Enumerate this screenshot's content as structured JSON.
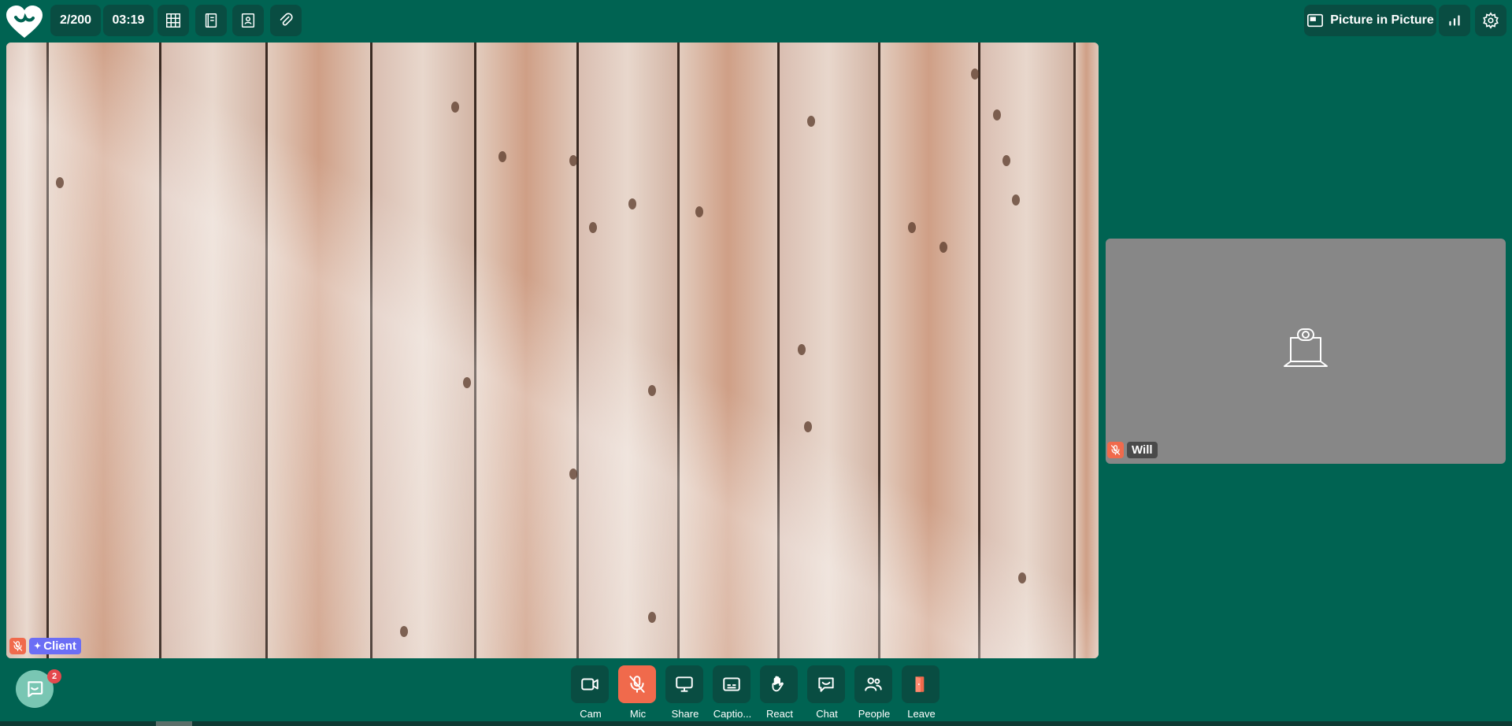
{
  "colors": {
    "background": "#006352",
    "pill": "#094d42",
    "danger": "#f06a4c",
    "client_tag": "#6b6ef5",
    "name_tag": "#4a4a4a"
  },
  "header": {
    "participants": "2/200",
    "timer": "03:19",
    "icons": [
      "grid-icon",
      "notebook-icon",
      "contact-card-icon",
      "paperclip-icon"
    ],
    "pip_label": "Picture in Picture",
    "right_icons": [
      "signal-bars-icon",
      "settings-gear-icon"
    ]
  },
  "main_video": {
    "participant_label": "Client",
    "muted": true
  },
  "side_tile": {
    "participant_label": "Will",
    "muted": true,
    "placeholder_icon": "camera-off-laptop-icon"
  },
  "controls": [
    {
      "id": "cam",
      "label": "Cam",
      "icon": "video-camera-icon"
    },
    {
      "id": "mic",
      "label": "Mic",
      "icon": "mic-off-icon",
      "active_danger": true
    },
    {
      "id": "share",
      "label": "Share",
      "icon": "screen-share-icon"
    },
    {
      "id": "captions",
      "label": "Captio...",
      "icon": "captions-icon"
    },
    {
      "id": "react",
      "label": "React",
      "icon": "hand-wave-icon"
    },
    {
      "id": "chat",
      "label": "Chat",
      "icon": "chat-bubble-icon"
    },
    {
      "id": "people",
      "label": "People",
      "icon": "people-icon"
    },
    {
      "id": "leave",
      "label": "Leave",
      "icon": "leave-door-icon"
    }
  ],
  "support_chat": {
    "icon": "chat-widget-icon",
    "badge_count": "2"
  }
}
